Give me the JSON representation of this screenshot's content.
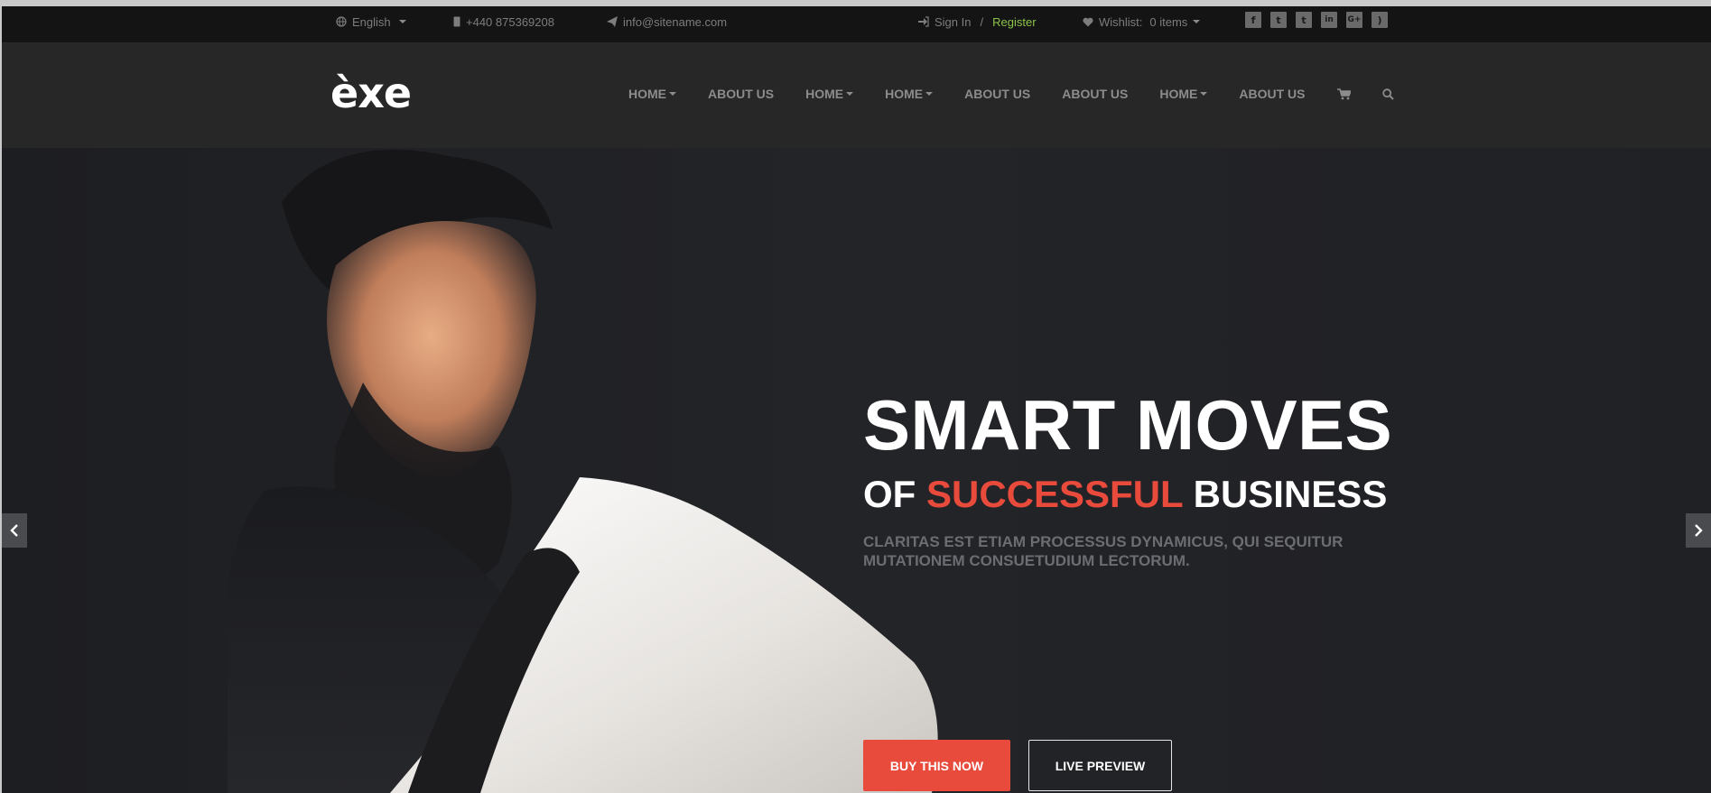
{
  "topbar": {
    "language": "English",
    "phone": "+440 875369208",
    "email": "info@sitename.com",
    "sign_in": "Sign In",
    "separator": "/",
    "register": "Register",
    "wishlist_label": "Wishlist:",
    "wishlist_count": "0 items",
    "social": [
      {
        "icon": "facebook-icon",
        "glyph": "f"
      },
      {
        "icon": "twitter-icon",
        "glyph": "t"
      },
      {
        "icon": "tumblr-icon",
        "glyph": "t"
      },
      {
        "icon": "linkedin-icon",
        "glyph": "in"
      },
      {
        "icon": "google-plus-icon",
        "glyph": "G+"
      },
      {
        "icon": "rss-icon",
        "glyph": ")"
      }
    ]
  },
  "header": {
    "logo": "èxe",
    "nav": [
      {
        "label": "HOME",
        "dropdown": true
      },
      {
        "label": "ABOUT US",
        "dropdown": false
      },
      {
        "label": "HOME",
        "dropdown": true
      },
      {
        "label": "HOME",
        "dropdown": true
      },
      {
        "label": "ABOUT US",
        "dropdown": false
      },
      {
        "label": "ABOUT US",
        "dropdown": false
      },
      {
        "label": "HOME",
        "dropdown": true
      },
      {
        "label": "ABOUT US",
        "dropdown": false
      }
    ]
  },
  "hero": {
    "title": "SMART MOVES",
    "subtitle_pre": "OF",
    "subtitle_accent": "SUCCESSFUL",
    "subtitle_post": "BUSINESS",
    "description": "CLARITAS EST ETIAM PROCESSUS DYNAMICUS, QUI SEQUITUR MUTATIONEM CONSUETUDIUM LECTORUM.",
    "buy_button": "BUY THIS NOW",
    "preview_button": "LIVE PREVIEW"
  },
  "colors": {
    "accent": "#e84a3c",
    "register": "#8bc34a",
    "topbar_bg": "#141414",
    "header_bg": "#272727",
    "hero_bg": "#1f2024"
  }
}
